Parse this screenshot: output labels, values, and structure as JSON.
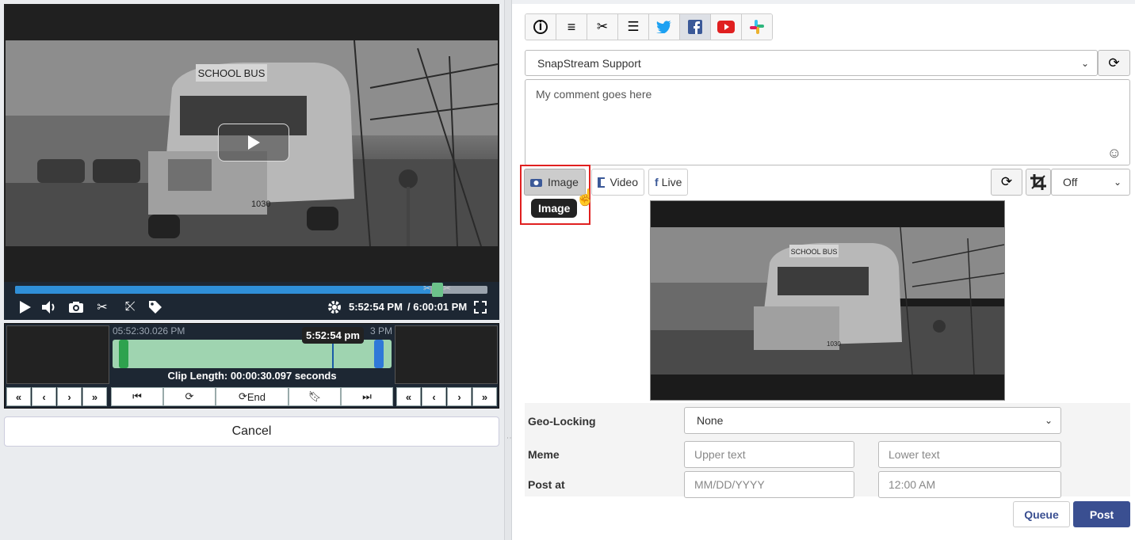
{
  "player": {
    "current_time": "5:52:54 PM",
    "duration": "/ 6:00:01 PM",
    "progress_fraction": 0.88
  },
  "trim": {
    "start_time": "05:52:30.026 PM",
    "end_time_partial": "3 PM",
    "playhead_tooltip": "5:52:54 pm",
    "clip_length": "Clip Length: 00:00:30.097 seconds",
    "end_label": "End"
  },
  "cancel_label": "Cancel",
  "scene_sign": "SCHOOL BUS",
  "bus_number": "1030",
  "share": {
    "account": "SnapStream Support",
    "comment": "My comment goes here",
    "media_buttons": {
      "image": "Image",
      "video": "Video",
      "live": "Live"
    },
    "tooltip": "Image",
    "crop_value": "Off"
  },
  "form": {
    "geo_label": "Geo-Locking",
    "geo_value": "None",
    "meme_label": "Meme",
    "upper_placeholder": "Upper text",
    "lower_placeholder": "Lower text",
    "post_label": "Post at",
    "date_placeholder": "MM/DD/YYYY",
    "time_placeholder": "12:00 AM"
  },
  "actions": {
    "queue": "Queue",
    "post": "Post"
  },
  "colors": {
    "twitter": "#1da1f2",
    "facebook": "#3b5998",
    "youtube": "#e02020",
    "post_bg": "#3a4f91",
    "highlight": "#e02020"
  }
}
